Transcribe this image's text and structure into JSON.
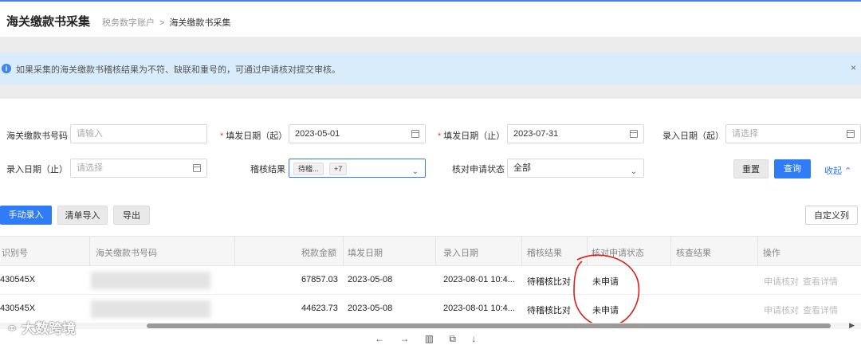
{
  "header": {
    "title": "海关缴款书采集",
    "breadcrumb_parent": "税务数字账户",
    "breadcrumb_sep": ">",
    "breadcrumb_current": "海关缴款书采集"
  },
  "alert": {
    "icon": "info-icon",
    "message": "如果采集的海关缴款书稽核结果为不符、缺联和重号的，可通过申请核对提交审核。",
    "close": "×"
  },
  "form": {
    "doc_no": {
      "label": "海关缴款书号码",
      "placeholder": "请输入"
    },
    "fill_date_start": {
      "label": "填发日期（起）",
      "value": "2023-05-01"
    },
    "fill_date_end": {
      "label": "填发日期（止）",
      "value": "2023-07-31"
    },
    "entry_date_start": {
      "label": "录入日期（起）",
      "placeholder": "请选择"
    },
    "entry_date_end": {
      "label": "录入日期（止）",
      "placeholder": "请选择"
    },
    "audit_result": {
      "label": "稽核结果",
      "tag": "待稽...",
      "more": "+7"
    },
    "check_status": {
      "label": "核对申请状态",
      "value": "全部"
    },
    "reset": "重置",
    "search": "查询",
    "collapse": "收起"
  },
  "toolbar": {
    "manual_entry": "手动录入",
    "list_import": "清单导入",
    "export": "导出",
    "custom_columns": "自定义列"
  },
  "table": {
    "headers": [
      "识别号",
      "海关缴款书号码",
      "税款金额",
      "填发日期",
      "录入日期",
      "稽核结果",
      "核对申请状态",
      "核查结果",
      "操作"
    ],
    "rows": [
      {
        "id": "430545X",
        "amount": "67857.03",
        "fill_date": "2023-05-08",
        "entry_date": "2023-08-01 10:4...",
        "audit": "待稽核比对",
        "status": "未申请",
        "check": "",
        "op1": "申请核对",
        "op2": "查看详情"
      },
      {
        "id": "430545X",
        "amount": "44623.73",
        "fill_date": "2023-05-08",
        "entry_date": "2023-08-01 10:4...",
        "audit": "待稽核比对",
        "status": "未申请",
        "check": "",
        "op1": "申请核对",
        "op2": "查看详情"
      }
    ]
  },
  "bottom_icons": [
    "←",
    "→",
    "▥",
    "⧉",
    "↓"
  ],
  "watermark": "大数跨境",
  "colors": {
    "primary": "#2f7cf6",
    "alert_bg": "#d9ecfb",
    "annotation": "#d9201c"
  }
}
